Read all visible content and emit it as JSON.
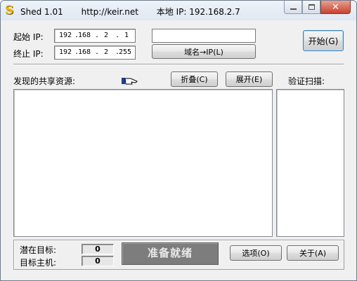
{
  "titlebar": {
    "app_icon": "S",
    "app_name": "Shed 1.01",
    "url": "http://keir.net",
    "local_ip": "本地 IP: 192.168.2.7"
  },
  "form": {
    "start_ip_label": "起始 IP:",
    "end_ip_label": "终止 IP:",
    "start_ip": [
      "192",
      "168",
      "2",
      "1"
    ],
    "end_ip": [
      "192",
      "168",
      "2",
      "255"
    ],
    "domain_input": "",
    "domain_to_ip_button": "域名→IP(L)",
    "start_button": "开始(G)"
  },
  "shares": {
    "label": "发现的共享资源:",
    "hand_icon": "hand-pointing-icon",
    "collapse_button": "折叠(C)",
    "expand_button": "展开(E)",
    "verify_label": "验证扫描:"
  },
  "footer": {
    "potential_targets_label": "潜在目标:",
    "target_hosts_label": "目标主机:",
    "potential_targets_count": "0",
    "target_hosts_count": "0",
    "status": "准备就绪",
    "options_button": "选项(O)",
    "about_button": "关于(A)"
  }
}
